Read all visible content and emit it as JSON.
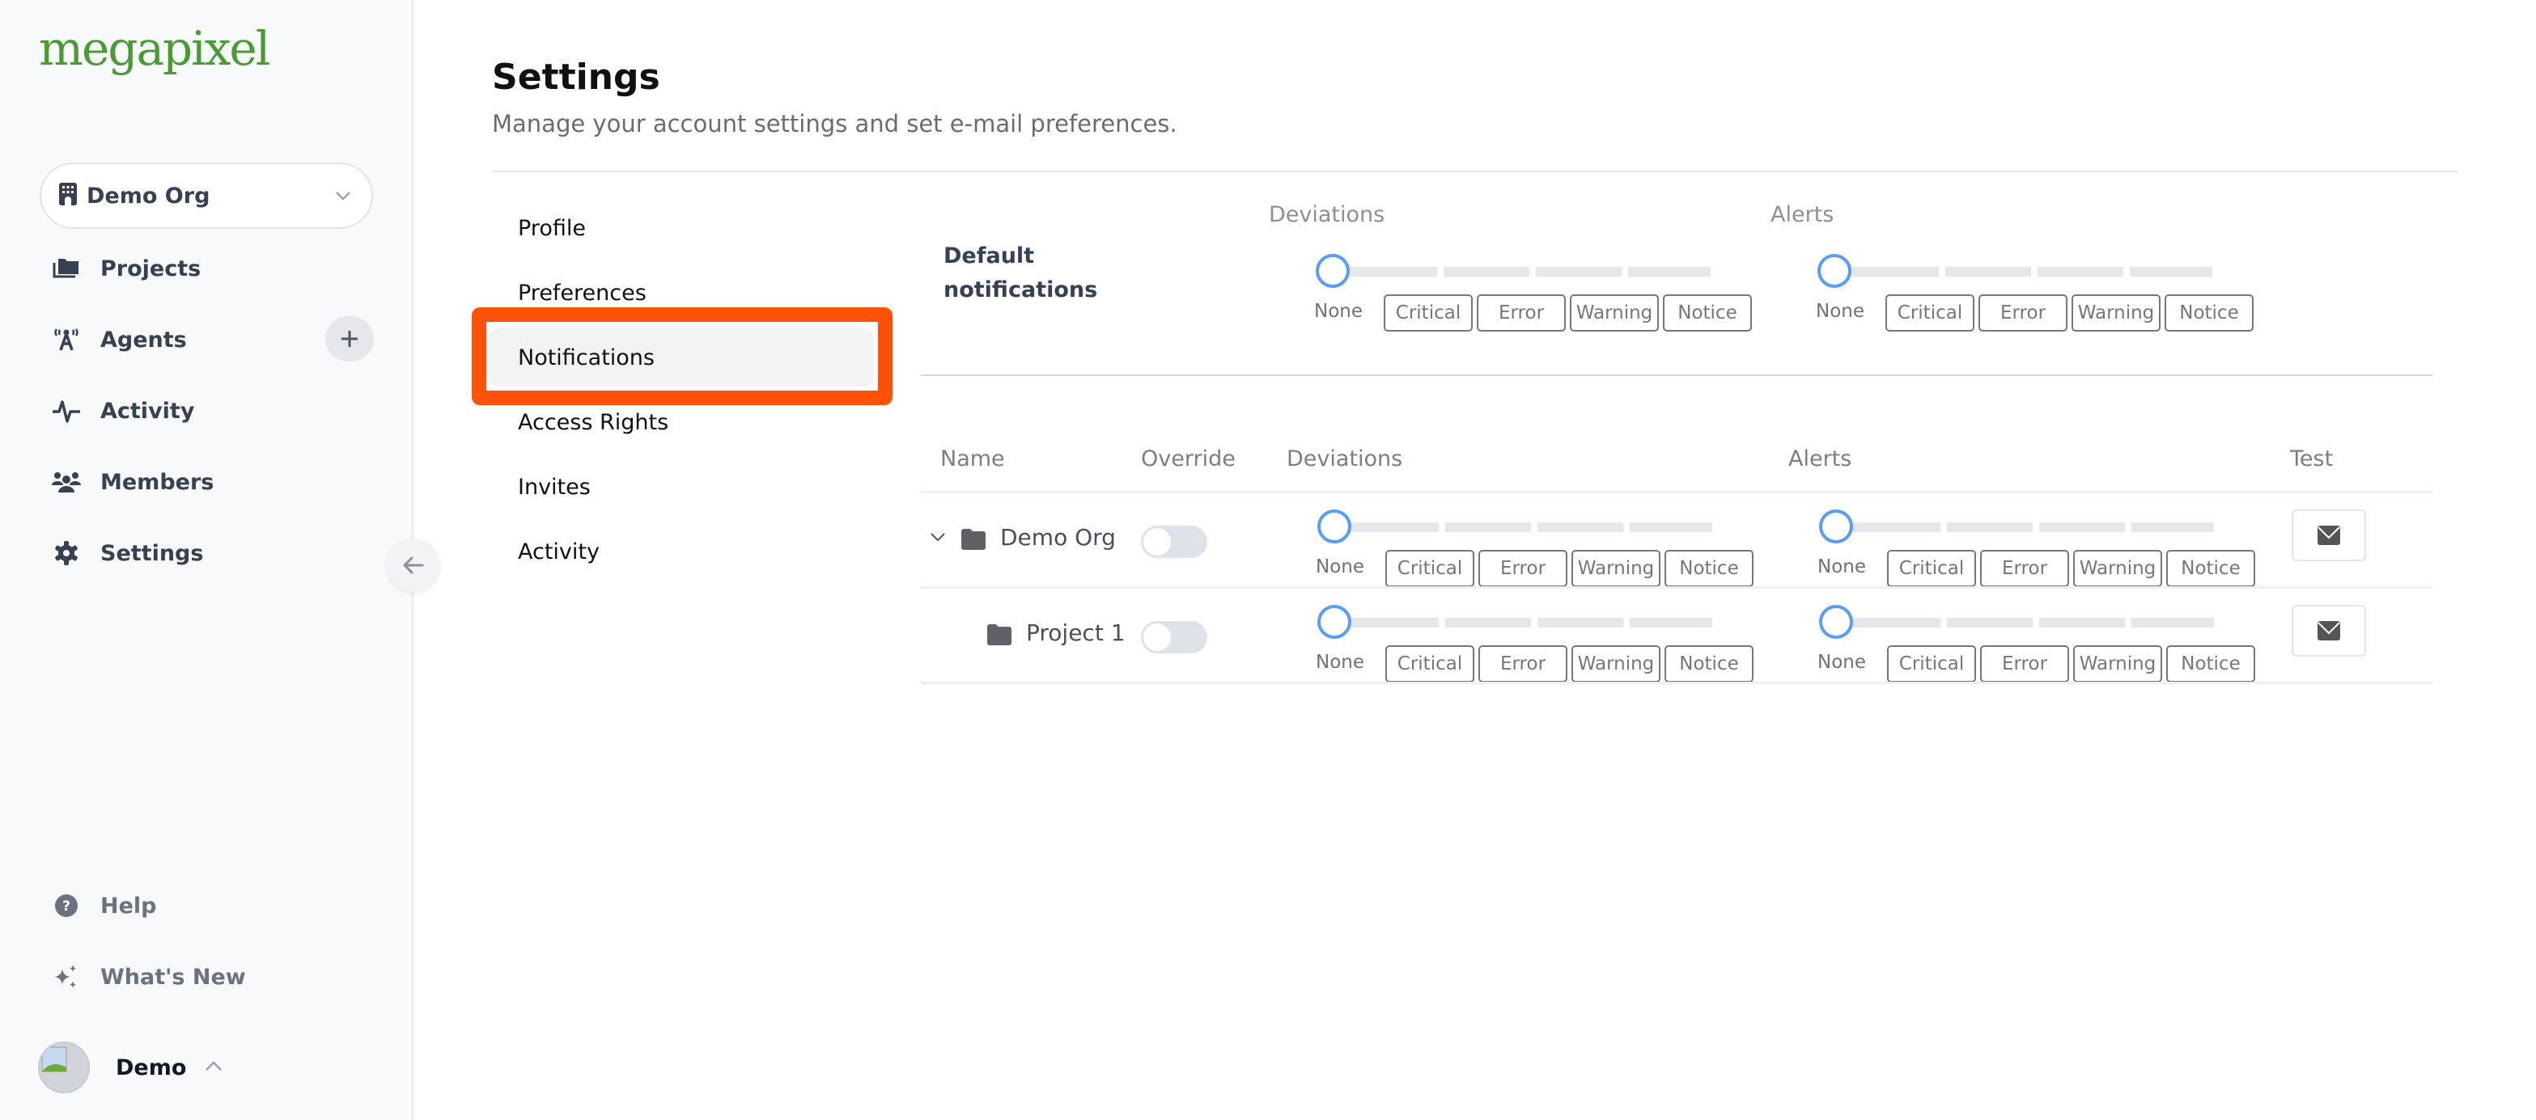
{
  "sidebar": {
    "logo": "megapixel",
    "org_selector": {
      "label": "Demo Org"
    },
    "nav": [
      {
        "label": "Projects",
        "icon": "folders-icon"
      },
      {
        "label": "Agents",
        "icon": "antenna-icon"
      },
      {
        "label": "Activity",
        "icon": "pulse-icon"
      },
      {
        "label": "Members",
        "icon": "users-icon"
      },
      {
        "label": "Settings",
        "icon": "gear-icon"
      }
    ],
    "bottom_nav": [
      {
        "label": "Help",
        "icon": "help-circle-icon"
      },
      {
        "label": "What's New",
        "icon": "sparkles-icon"
      }
    ],
    "user": {
      "name": "Demo"
    }
  },
  "page": {
    "title": "Settings",
    "subtitle": "Manage your account settings and set e-mail preferences."
  },
  "tabs": [
    {
      "label": "Profile",
      "active": false
    },
    {
      "label": "Preferences",
      "active": false
    },
    {
      "label": "Notifications",
      "active": true
    },
    {
      "label": "Access Rights",
      "active": false
    },
    {
      "label": "Invites",
      "active": false
    },
    {
      "label": "Activity",
      "active": false
    }
  ],
  "levels": [
    "Critical",
    "Error",
    "Warning",
    "Notice"
  ],
  "none_label": "None",
  "defaults": {
    "label_line1": "Default",
    "label_line2": "notifications",
    "deviations_header": "Deviations",
    "alerts_header": "Alerts",
    "deviations_level": "None",
    "alerts_level": "None"
  },
  "table": {
    "headers": {
      "name": "Name",
      "override": "Override",
      "deviations": "Deviations",
      "alerts": "Alerts",
      "test": "Test"
    },
    "rows": [
      {
        "name": "Demo Org",
        "expanded": true,
        "override": false,
        "deviations_level": "None",
        "alerts_level": "None"
      },
      {
        "name": "Project 1",
        "expanded": false,
        "override": false,
        "deviations_level": "None",
        "alerts_level": "None"
      }
    ]
  },
  "colors": {
    "brand": "#4a9a35",
    "highlight": "#ff5108",
    "slider_knob": "#5b9cf5"
  }
}
